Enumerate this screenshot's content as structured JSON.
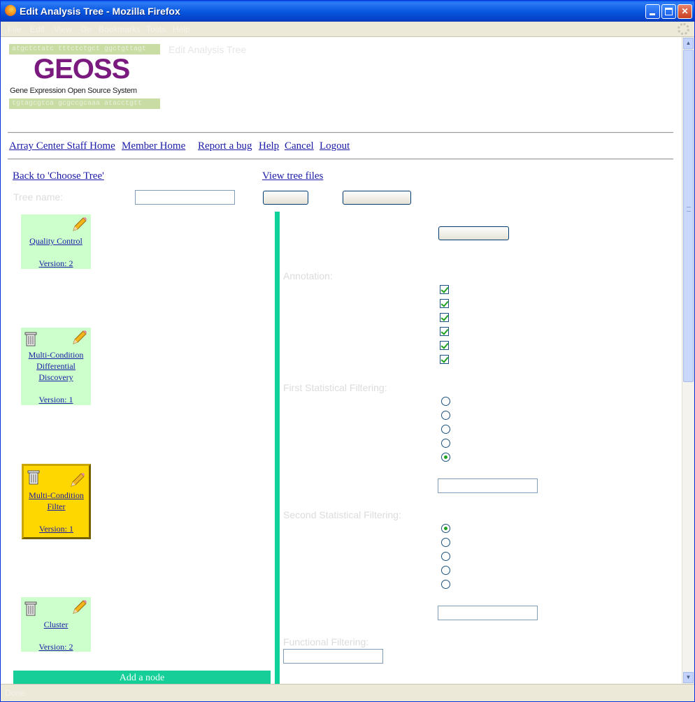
{
  "window": {
    "title": "Edit Analysis Tree - Mozilla Firefox"
  },
  "menubar": {
    "items": [
      "File",
      "Edit",
      "View",
      "Go",
      "Bookmarks",
      "Tools",
      "Help"
    ]
  },
  "header": {
    "dna_top": "atgctctatc tttctctgct ggctgttagt",
    "dna_bottom": "tgtagcgtca gcgccgcaaa atacctgtt",
    "logo": "GEOSS",
    "logo_subtitle": "Gene Expression Open Source System",
    "page_title": "Edit Analysis Tree"
  },
  "nav": {
    "links": [
      "Array Center Staff Home",
      "Member Home",
      "Report a bug",
      "Help",
      "Cancel",
      "Logout"
    ]
  },
  "tree_controls": {
    "back_link": "Back to 'Choose Tree'",
    "view_files_link": "View tree files",
    "tree_name_label": "Tree name:",
    "tree_name_value": "",
    "button_1": "",
    "button_2": ""
  },
  "nodes": [
    {
      "name": "Quality Control",
      "version": "Version: 2",
      "active": false,
      "deletable": false
    },
    {
      "name": "Multi-Condition Differential Discovery",
      "version": "Version: 1",
      "active": false,
      "deletable": true
    },
    {
      "name": "Multi-Condition Filter",
      "version": "Version: 1",
      "active": true,
      "deletable": true
    },
    {
      "name": "Cluster",
      "version": "Version: 2",
      "active": false,
      "deletable": true
    }
  ],
  "add_node_label": "Add a node",
  "properties": {
    "annotation_label": "Annotation:",
    "first_filter_label": "First Statistical Filtering:",
    "second_filter_label": "Second Statistical Filtering:",
    "functional_filter_label": "Functional Filtering:",
    "annotation_checked": [
      true,
      true,
      true,
      true,
      true,
      true
    ],
    "first_filter_selected_index": 4,
    "second_filter_selected_index": 0,
    "first_filter_value": "",
    "second_filter_value": "",
    "functional_value": ""
  },
  "status": {
    "text": "Done"
  },
  "colors": {
    "node_bg": "#ccffcc",
    "active_node_bg": "#ffd700",
    "divider": "#0fd19a",
    "logo": "#7b1a7e",
    "link": "#1a1aa6"
  }
}
